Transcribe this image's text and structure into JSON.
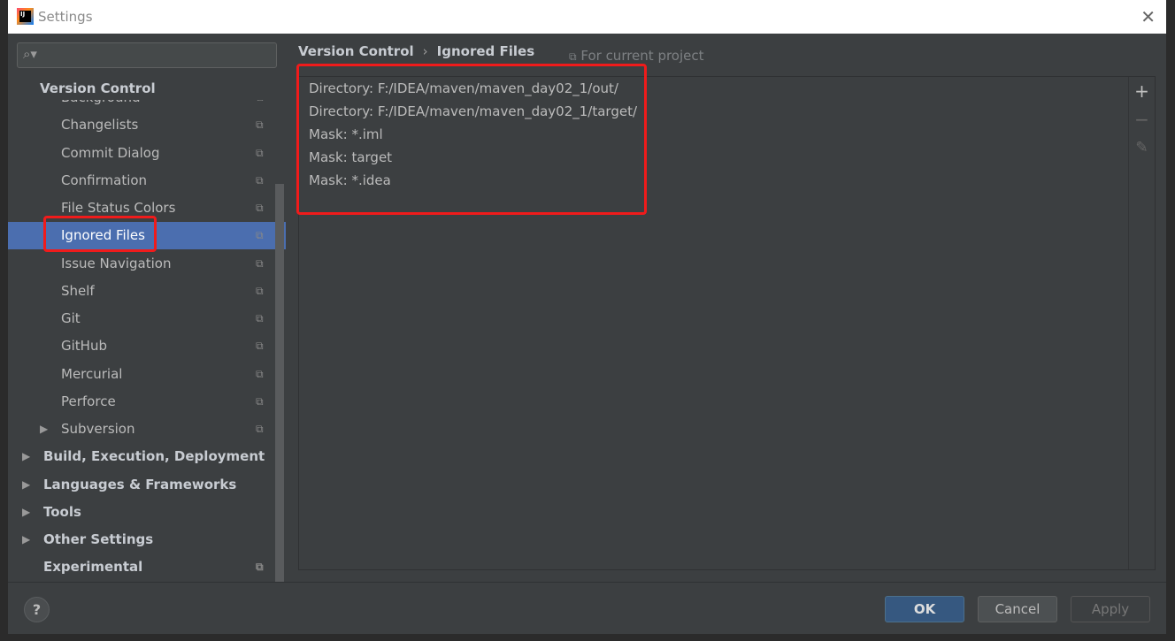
{
  "window": {
    "title": "Settings",
    "close_icon": "close-icon"
  },
  "search": {
    "placeholder": ""
  },
  "sidebar": {
    "section_header": "Version Control",
    "items": [
      {
        "label": "Background",
        "level": 2,
        "partial": true,
        "copy": true
      },
      {
        "label": "Changelists",
        "level": 2,
        "copy": true
      },
      {
        "label": "Commit Dialog",
        "level": 2,
        "copy": true
      },
      {
        "label": "Confirmation",
        "level": 2,
        "copy": true
      },
      {
        "label": "File Status Colors",
        "level": 2,
        "copy": true
      },
      {
        "label": "Ignored Files",
        "level": 2,
        "copy": true,
        "selected": true
      },
      {
        "label": "Issue Navigation",
        "level": 2,
        "copy": true
      },
      {
        "label": "Shelf",
        "level": 2,
        "copy": true
      },
      {
        "label": "Git",
        "level": 2,
        "copy": true
      },
      {
        "label": "GitHub",
        "level": 2,
        "copy": true
      },
      {
        "label": "Mercurial",
        "level": 2,
        "copy": true
      },
      {
        "label": "Perforce",
        "level": 2,
        "copy": true
      },
      {
        "label": "Subversion",
        "level": 2,
        "copy": true,
        "expandable": true
      },
      {
        "label": "Build, Execution, Deployment",
        "level": 1,
        "expandable": true
      },
      {
        "label": "Languages & Frameworks",
        "level": 1,
        "expandable": true
      },
      {
        "label": "Tools",
        "level": 1,
        "expandable": true
      },
      {
        "label": "Other Settings",
        "level": 1,
        "expandable": true
      },
      {
        "label": "Experimental",
        "level": 1,
        "copy": true
      }
    ]
  },
  "breadcrumb": {
    "parent": "Version Control",
    "separator": "›",
    "current": "Ignored Files"
  },
  "scope": "For current project",
  "ignored": [
    "Directory: F:/IDEA/maven/maven_day02_1/out/",
    "Directory: F:/IDEA/maven/maven_day02_1/target/",
    "Mask: *.iml",
    "Mask: target",
    "Mask: *.idea"
  ],
  "toolbar": {
    "add": "+",
    "remove": "−"
  },
  "buttons": {
    "ok": "OK",
    "cancel": "Cancel",
    "apply": "Apply",
    "help": "?"
  },
  "colors": {
    "selection": "#4b6eaf",
    "highlight_box": "#f01b1b",
    "ok_button": "#365880"
  }
}
